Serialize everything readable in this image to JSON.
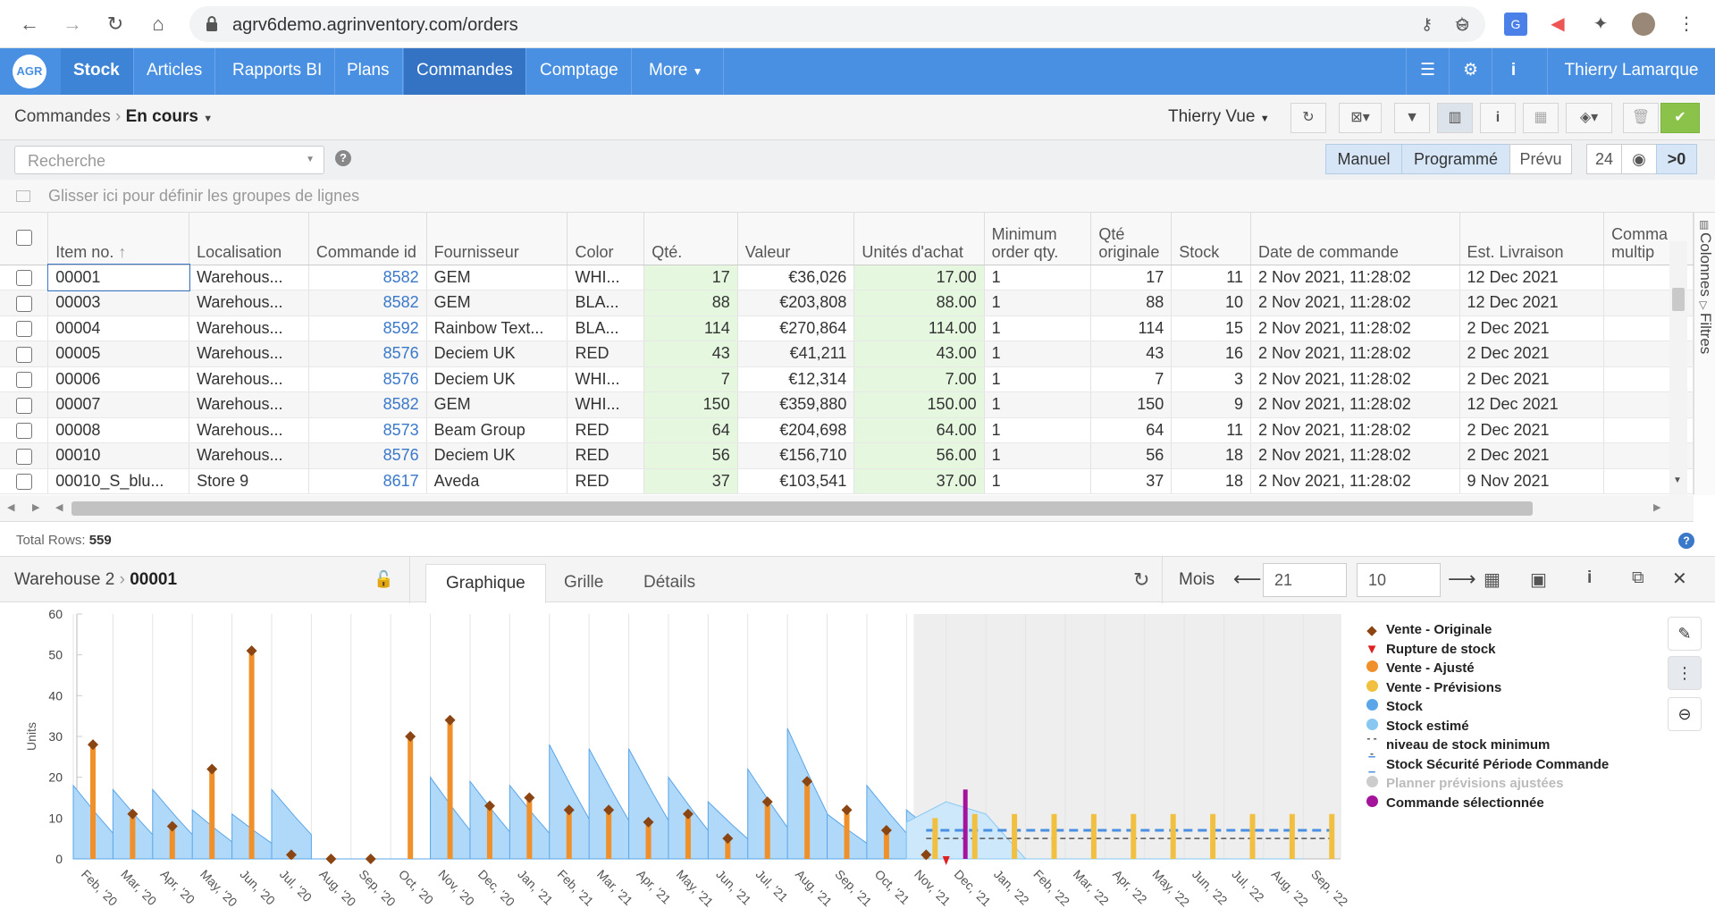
{
  "browser": {
    "url": "agrv6demo.agrinventory.com/orders"
  },
  "nav": {
    "logo": "AGR",
    "items": [
      "Stock",
      "Articles",
      "Rapports BI",
      "Plans",
      "Commandes",
      "Comptage",
      "More"
    ],
    "active": "Commandes",
    "user": "Thierry Lamarque"
  },
  "breadcrumb": {
    "parent": "Commandes",
    "current": "En cours"
  },
  "view": {
    "label": "Thierry Vue"
  },
  "search": {
    "placeholder": "Recherche"
  },
  "mode_segments": [
    "Manuel",
    "Programmé",
    "Prévu"
  ],
  "mode_active": [
    "Manuel",
    "Programmé"
  ],
  "count_24": "24",
  "count_gt0": ">0",
  "group_hint": "Glisser ici pour définir les groupes de lignes",
  "grid": {
    "columns": [
      "Item no.",
      "Localisation",
      "Commande id",
      "Fournisseur",
      "Color",
      "Qté.",
      "Valeur",
      "Unités d'achat",
      "Minimum order qty.",
      "Qté originale",
      "Stock",
      "Date de commande",
      "Est. Livraison",
      "Comma multip"
    ],
    "rows": [
      [
        "00001",
        "Warehous...",
        "8582",
        "GEM",
        "WHI...",
        "17",
        "€36,026",
        "17.00",
        "1",
        "17",
        "11",
        "2 Nov 2021, 11:28:02",
        "12 Dec 2021"
      ],
      [
        "00003",
        "Warehous...",
        "8582",
        "GEM",
        "BLA...",
        "88",
        "€203,808",
        "88.00",
        "1",
        "88",
        "10",
        "2 Nov 2021, 11:28:02",
        "12 Dec 2021"
      ],
      [
        "00004",
        "Warehous...",
        "8592",
        "Rainbow Text...",
        "BLA...",
        "114",
        "€270,864",
        "114.00",
        "1",
        "114",
        "15",
        "2 Nov 2021, 11:28:02",
        "2 Dec 2021"
      ],
      [
        "00005",
        "Warehous...",
        "8576",
        "Deciem UK",
        "RED",
        "43",
        "€41,211",
        "43.00",
        "1",
        "43",
        "16",
        "2 Nov 2021, 11:28:02",
        "2 Dec 2021"
      ],
      [
        "00006",
        "Warehous...",
        "8576",
        "Deciem UK",
        "WHI...",
        "7",
        "€12,314",
        "7.00",
        "1",
        "7",
        "3",
        "2 Nov 2021, 11:28:02",
        "2 Dec 2021"
      ],
      [
        "00007",
        "Warehous...",
        "8582",
        "GEM",
        "WHI...",
        "150",
        "€359,880",
        "150.00",
        "1",
        "150",
        "9",
        "2 Nov 2021, 11:28:02",
        "12 Dec 2021"
      ],
      [
        "00008",
        "Warehous...",
        "8573",
        "Beam Group",
        "RED",
        "64",
        "€204,698",
        "64.00",
        "1",
        "64",
        "11",
        "2 Nov 2021, 11:28:02",
        "2 Dec 2021"
      ],
      [
        "00010",
        "Warehous...",
        "8576",
        "Deciem UK",
        "RED",
        "56",
        "€156,710",
        "56.00",
        "1",
        "56",
        "18",
        "2 Nov 2021, 11:28:02",
        "2 Dec 2021"
      ],
      [
        "00010_S_blu...",
        "Store 9",
        "8617",
        "Aveda",
        "RED",
        "37",
        "€103,541",
        "37.00",
        "1",
        "37",
        "18",
        "2 Nov 2021, 11:28:02",
        "9 Nov 2021"
      ]
    ]
  },
  "side_tabs": [
    "Colonnes",
    "Filtres"
  ],
  "total_rows": {
    "label": "Total Rows:",
    "value": "559"
  },
  "detail": {
    "location": "Warehouse 2",
    "item": "00001",
    "tabs": [
      "Graphique",
      "Grille",
      "Détails"
    ],
    "active_tab": "Graphique",
    "period_label": "Mois",
    "field1": "21",
    "field2": "10"
  },
  "colors": {
    "nav": "#4a90e2",
    "vente_originale": "#8b4513",
    "rupture": "#e02020",
    "vente_ajuste": "#f0902a",
    "vente_previsions": "#f2c040",
    "stock": "#5aa6e8",
    "stock_estime": "#87c7f2",
    "commande": "#a4139b"
  },
  "chart_data": {
    "type": "bar",
    "ylabel": "Units",
    "ylim": [
      0,
      60
    ],
    "yticks": [
      0,
      10,
      20,
      30,
      40,
      50,
      60
    ],
    "categories": [
      "Feb, '20",
      "Mar, '20",
      "Apr, '20",
      "May, '20",
      "Jun, '20",
      "Jul, '20",
      "Aug, '20",
      "Sep, '20",
      "Oct, '20",
      "Nov, '20",
      "Dec, '20",
      "Jan, '21",
      "Feb, '21",
      "Mar, '21",
      "Apr, '21",
      "May, '21",
      "Jun, '21",
      "Jul, '21",
      "Aug, '21",
      "Sep, '21",
      "Oct, '21",
      "Nov, '21",
      "Dec, '21",
      "Jan, '22",
      "Feb, '22",
      "Mar, '22",
      "Apr, '22",
      "May, '22",
      "Jun, '22",
      "Jul, '22",
      "Aug, '22",
      "Sep, '22"
    ],
    "legend": [
      "Vente - Originale",
      "Rupture de stock",
      "Vente - Ajusté",
      "Vente - Prévisions",
      "Stock",
      "Stock estimé",
      "niveau de stock minimum",
      "Stock Sécurité Période Commande",
      "Planner prévisions ajustées",
      "Commande sélectionnée"
    ],
    "series": [
      {
        "name": "Vente - Originale",
        "values": [
          28,
          11,
          8,
          22,
          51,
          1,
          0,
          0,
          30,
          34,
          13,
          15,
          12,
          12,
          9,
          11,
          5,
          14,
          19,
          12,
          7,
          1,
          null,
          null,
          null,
          null,
          null,
          null,
          null,
          null,
          null,
          null
        ]
      },
      {
        "name": "Vente - Ajusté",
        "values": [
          28,
          11,
          8,
          22,
          51,
          1,
          0,
          0,
          30,
          34,
          13,
          15,
          12,
          12,
          9,
          11,
          5,
          14,
          19,
          12,
          7,
          1,
          null,
          null,
          null,
          null,
          null,
          null,
          null,
          null,
          null,
          null
        ]
      },
      {
        "name": "Vente - Prévisions",
        "values": [
          null,
          null,
          null,
          null,
          null,
          null,
          null,
          null,
          null,
          null,
          null,
          null,
          null,
          null,
          null,
          null,
          null,
          null,
          null,
          null,
          null,
          10,
          11,
          11,
          11,
          11,
          11,
          11,
          11,
          11,
          11,
          11
        ]
      },
      {
        "name": "Stock",
        "values": [
          18,
          17,
          17,
          12,
          11,
          17,
          0,
          0,
          0,
          20,
          19,
          18,
          28,
          27,
          27,
          20,
          14,
          22,
          32,
          11,
          18,
          12,
          null,
          null,
          null,
          null,
          null,
          null,
          null,
          null,
          null,
          null
        ]
      },
      {
        "name": "Stock estimé",
        "values": [
          null,
          null,
          null,
          null,
          null,
          null,
          null,
          null,
          null,
          null,
          null,
          null,
          null,
          null,
          null,
          null,
          null,
          null,
          null,
          null,
          null,
          9,
          14,
          11,
          0,
          0,
          0,
          0,
          0,
          0,
          0,
          0
        ]
      },
      {
        "name": "niveau de stock minimum",
        "values": [
          null,
          null,
          null,
          null,
          null,
          null,
          null,
          null,
          null,
          null,
          null,
          null,
          null,
          null,
          null,
          null,
          null,
          null,
          null,
          null,
          null,
          5,
          5,
          5,
          5,
          5,
          5,
          5,
          5,
          5,
          5,
          5
        ]
      },
      {
        "name": "Stock Sécurité Période Commande",
        "values": [
          null,
          null,
          null,
          null,
          null,
          null,
          null,
          null,
          null,
          null,
          null,
          null,
          null,
          null,
          null,
          null,
          null,
          null,
          null,
          null,
          null,
          7,
          7,
          7,
          7,
          7,
          7,
          7,
          7,
          7,
          7,
          7
        ]
      },
      {
        "name": "Commande sélectionnée",
        "values": [
          null,
          null,
          null,
          null,
          null,
          null,
          null,
          null,
          null,
          null,
          null,
          null,
          null,
          null,
          null,
          null,
          null,
          null,
          null,
          null,
          null,
          null,
          17,
          null,
          null,
          null,
          null,
          null,
          null,
          null,
          null,
          null
        ]
      }
    ],
    "rupture_at": "Dec, '21",
    "forecast_start": "Nov, '21"
  }
}
